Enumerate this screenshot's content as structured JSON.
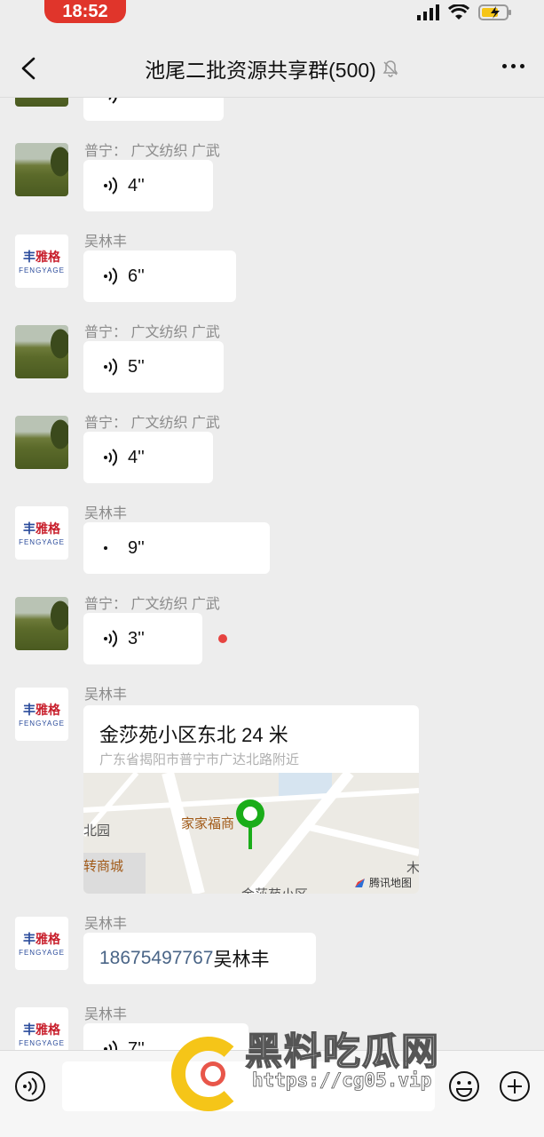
{
  "status_bar": {
    "time": "18:52"
  },
  "header": {
    "title": "池尾二批资源共享群(500)"
  },
  "messages": [
    {
      "type": "voice",
      "sender": "",
      "duration": "",
      "avatar": "photo"
    },
    {
      "type": "voice",
      "sender": "普宁：  广文纺织 广武",
      "duration": "4''",
      "avatar": "photo"
    },
    {
      "type": "voice",
      "sender": "吴林丰",
      "duration": "6''",
      "avatar": "logo"
    },
    {
      "type": "voice",
      "sender": "普宁：  广文纺织 广武",
      "duration": "5''",
      "avatar": "photo"
    },
    {
      "type": "voice",
      "sender": "普宁：  广文纺织 广武",
      "duration": "4''",
      "avatar": "photo"
    },
    {
      "type": "voice",
      "sender": "吴林丰",
      "duration": "9''",
      "avatar": "logo"
    },
    {
      "type": "voice",
      "sender": "普宁：  广文纺织 广武",
      "duration": "3''",
      "avatar": "photo",
      "unread": true
    },
    {
      "type": "location",
      "sender": "吴林丰",
      "avatar": "logo"
    },
    {
      "type": "contact",
      "sender": "吴林丰",
      "avatar": "logo"
    },
    {
      "type": "voice",
      "sender": "吴林丰",
      "duration": "7''",
      "avatar": "logo"
    }
  ],
  "location": {
    "title": "金莎苑小区东北 24 米",
    "address": "广东省揭阳市普宁市广达北路附近",
    "map_labels": {
      "shop": "家家福商",
      "park": "北园",
      "mall": "转商城",
      "wood": "木",
      "community": "金莎苑小区"
    },
    "map_credit": "腾讯地图"
  },
  "contact": {
    "phone": "18675497767",
    "name": "吴林丰"
  },
  "avatar_logo": {
    "cn": "丰雅格",
    "en": "FENGYAGE",
    "mark": "•"
  },
  "watermark": {
    "title": "黑料吃瓜网",
    "url": "https://cg05.vip"
  },
  "colors": {
    "accent": "#e0352b",
    "unread": "#e64340",
    "phone_link": "#4a6587",
    "pin": "#1aad19"
  }
}
